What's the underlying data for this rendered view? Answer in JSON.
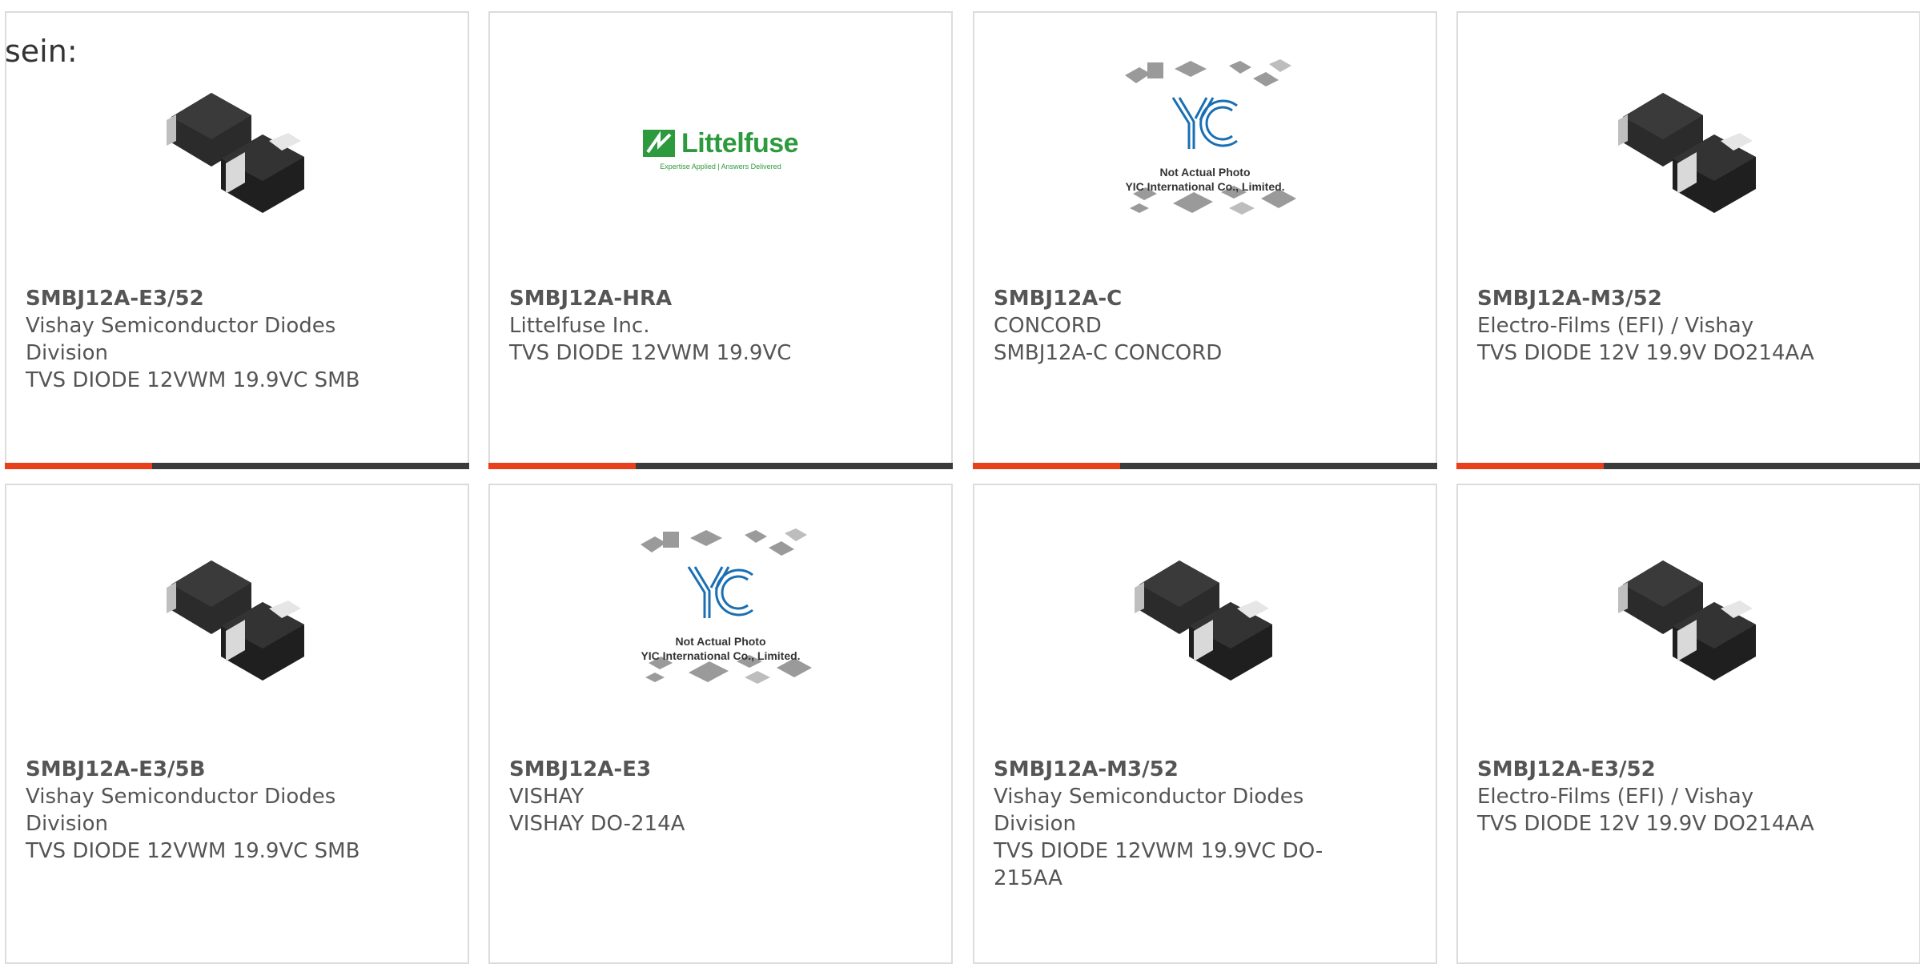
{
  "intro_text": "sein:",
  "products": [
    {
      "part": "SMBJ12A-E3/52",
      "lines": [
        "Vishay Semiconductor Diodes",
        "Division",
        "TVS DIODE 12VWM 19.9VC SMB"
      ],
      "image": "diode-smb-photo"
    },
    {
      "part": "SMBJ12A-HRA",
      "lines": [
        "Littelfuse Inc.",
        "TVS DIODE 12VWM 19.9VC"
      ],
      "image": "littelfuse-logo"
    },
    {
      "part": "SMBJ12A-C",
      "lines": [
        "CONCORD",
        "SMBJ12A-C CONCORD"
      ],
      "image": "yic-placeholder"
    },
    {
      "part": "SMBJ12A-M3/52",
      "lines": [
        "Electro-Films (EFI) / Vishay",
        "TVS DIODE 12V 19.9V DO214AA"
      ],
      "image": "diode-smb-photo"
    },
    {
      "part": "SMBJ12A-E3/5B",
      "lines": [
        "Vishay Semiconductor Diodes",
        "Division",
        "TVS DIODE 12VWM 19.9VC SMB"
      ],
      "image": "diode-smb-photo"
    },
    {
      "part": "SMBJ12A-E3",
      "lines": [
        "VISHAY",
        "VISHAY DO-214A"
      ],
      "image": "yic-placeholder"
    },
    {
      "part": "SMBJ12A-M3/52",
      "lines": [
        "Vishay Semiconductor Diodes",
        "Division",
        "TVS DIODE 12VWM 19.9VC DO-",
        "215AA"
      ],
      "image": "diode-smb-photo"
    },
    {
      "part": "SMBJ12A-E3/52",
      "lines": [
        "Electro-Films (EFI) / Vishay",
        "TVS DIODE 12V 19.9V DO214AA"
      ],
      "image": "diode-smb-photo"
    }
  ],
  "littelfuse": {
    "name": "Littelfuse",
    "tagline": "Expertise Applied | Answers Delivered"
  },
  "yic": {
    "line1": "Not Actual Photo",
    "line2": "YIC International Co., Limited."
  },
  "colors": {
    "accent": "#e8401c",
    "bar": "#3b3b3b",
    "border": "#dcdcdc",
    "lf_green": "#2e9a3e",
    "yic_blue": "#1a6fb3"
  }
}
